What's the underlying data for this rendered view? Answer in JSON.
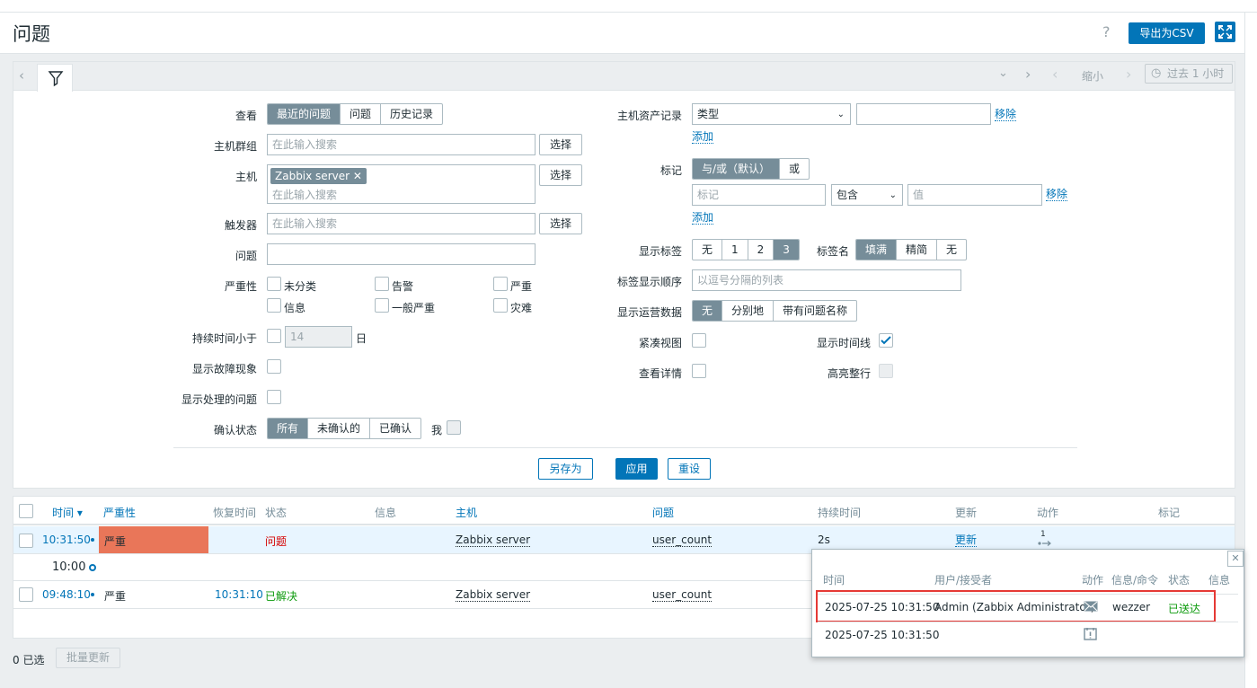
{
  "header": {
    "title": "问题",
    "help": "?",
    "export_label": "导出为CSV"
  },
  "filter_bar": {
    "zoom_out": "缩小",
    "time_range": "过去 1 小时"
  },
  "filter": {
    "view_label": "查看",
    "view_options": [
      "最近的问题",
      "问题",
      "历史记录"
    ],
    "host_group_label": "主机群组",
    "search_placeholder": "在此输入搜索",
    "select_label": "选择",
    "host_label": "主机",
    "host_chip": "Zabbix server",
    "trigger_label": "触发器",
    "problem_label": "问题",
    "severity_label": "严重性",
    "severities": [
      "未分类",
      "告警",
      "严重",
      "信息",
      "一般严重",
      "灾难"
    ],
    "age_label": "持续时间小于",
    "age_value": "14",
    "age_unit": "日",
    "symptoms_label": "显示故障现象",
    "suppressed_label": "显示处理的问题",
    "ack_label": "确认状态",
    "ack_options": [
      "所有",
      "未确认的",
      "已确认"
    ],
    "ack_me": "我",
    "inventory_label": "主机资产记录",
    "inventory_select": "类型",
    "remove_label": "移除",
    "add_label": "添加",
    "tags_label": "标记",
    "tags_op_options": [
      "与/或（默认）",
      "或"
    ],
    "tag_placeholder": "标记",
    "tag_op_select": "包含",
    "value_placeholder": "值",
    "show_tags_label": "显示标签",
    "show_tags_options": [
      "无",
      "1",
      "2",
      "3"
    ],
    "tag_name_label": "标签名",
    "tag_name_options": [
      "填满",
      "精简",
      "无"
    ],
    "tag_priority_label": "标签显示顺序",
    "tag_priority_placeholder": "以逗号分隔的列表",
    "opdata_label": "显示运营数据",
    "opdata_options": [
      "无",
      "分别地",
      "带有问题名称"
    ],
    "compact_label": "紧凑视图",
    "timeline_label": "显示时间线",
    "details_label": "查看详情",
    "highlight_label": "高亮整行",
    "save_as": "另存为",
    "apply": "应用",
    "reset": "重设"
  },
  "table": {
    "columns": [
      "时间 ▾",
      "严重性",
      "恢复时间",
      "状态",
      "信息",
      "主机",
      "问题",
      "持续时间",
      "更新",
      "动作",
      "标记"
    ],
    "rows": [
      {
        "time": "10:31:50",
        "severity": "严重",
        "recovery": "",
        "status": "问题",
        "host": "Zabbix server",
        "problem": "user_count",
        "duration": "2s",
        "update": "更新",
        "actions_count": "1"
      },
      {
        "time": "09:48:10",
        "severity": "严重",
        "recovery": "10:31:10",
        "status": "已解决",
        "host": "Zabbix server",
        "problem": "user_count",
        "duration": "",
        "update": "",
        "actions_count": ""
      }
    ],
    "timeline_marker": "10:00",
    "selected_count": "0 已选",
    "mass_update": "批量更新"
  },
  "popup": {
    "columns": [
      "时间",
      "用户/接受者",
      "动作",
      "信息/命令",
      "状态",
      "信息"
    ],
    "rows": [
      {
        "time": "2025-07-25 10:31:50",
        "user": "Admin (Zabbix Administrator)",
        "action_icon": "envelope-icon",
        "message": "wezzer",
        "status": "已送达"
      },
      {
        "time": "2025-07-25 10:31:50",
        "user": "",
        "action_icon": "problem-created-icon",
        "message": "",
        "status": ""
      }
    ]
  },
  "colors": {
    "accent": "#0275b8",
    "high_severity": "#e97659",
    "problem": "#d50000",
    "resolved": "#0c9a0c",
    "highlight_box": "#e53935"
  }
}
